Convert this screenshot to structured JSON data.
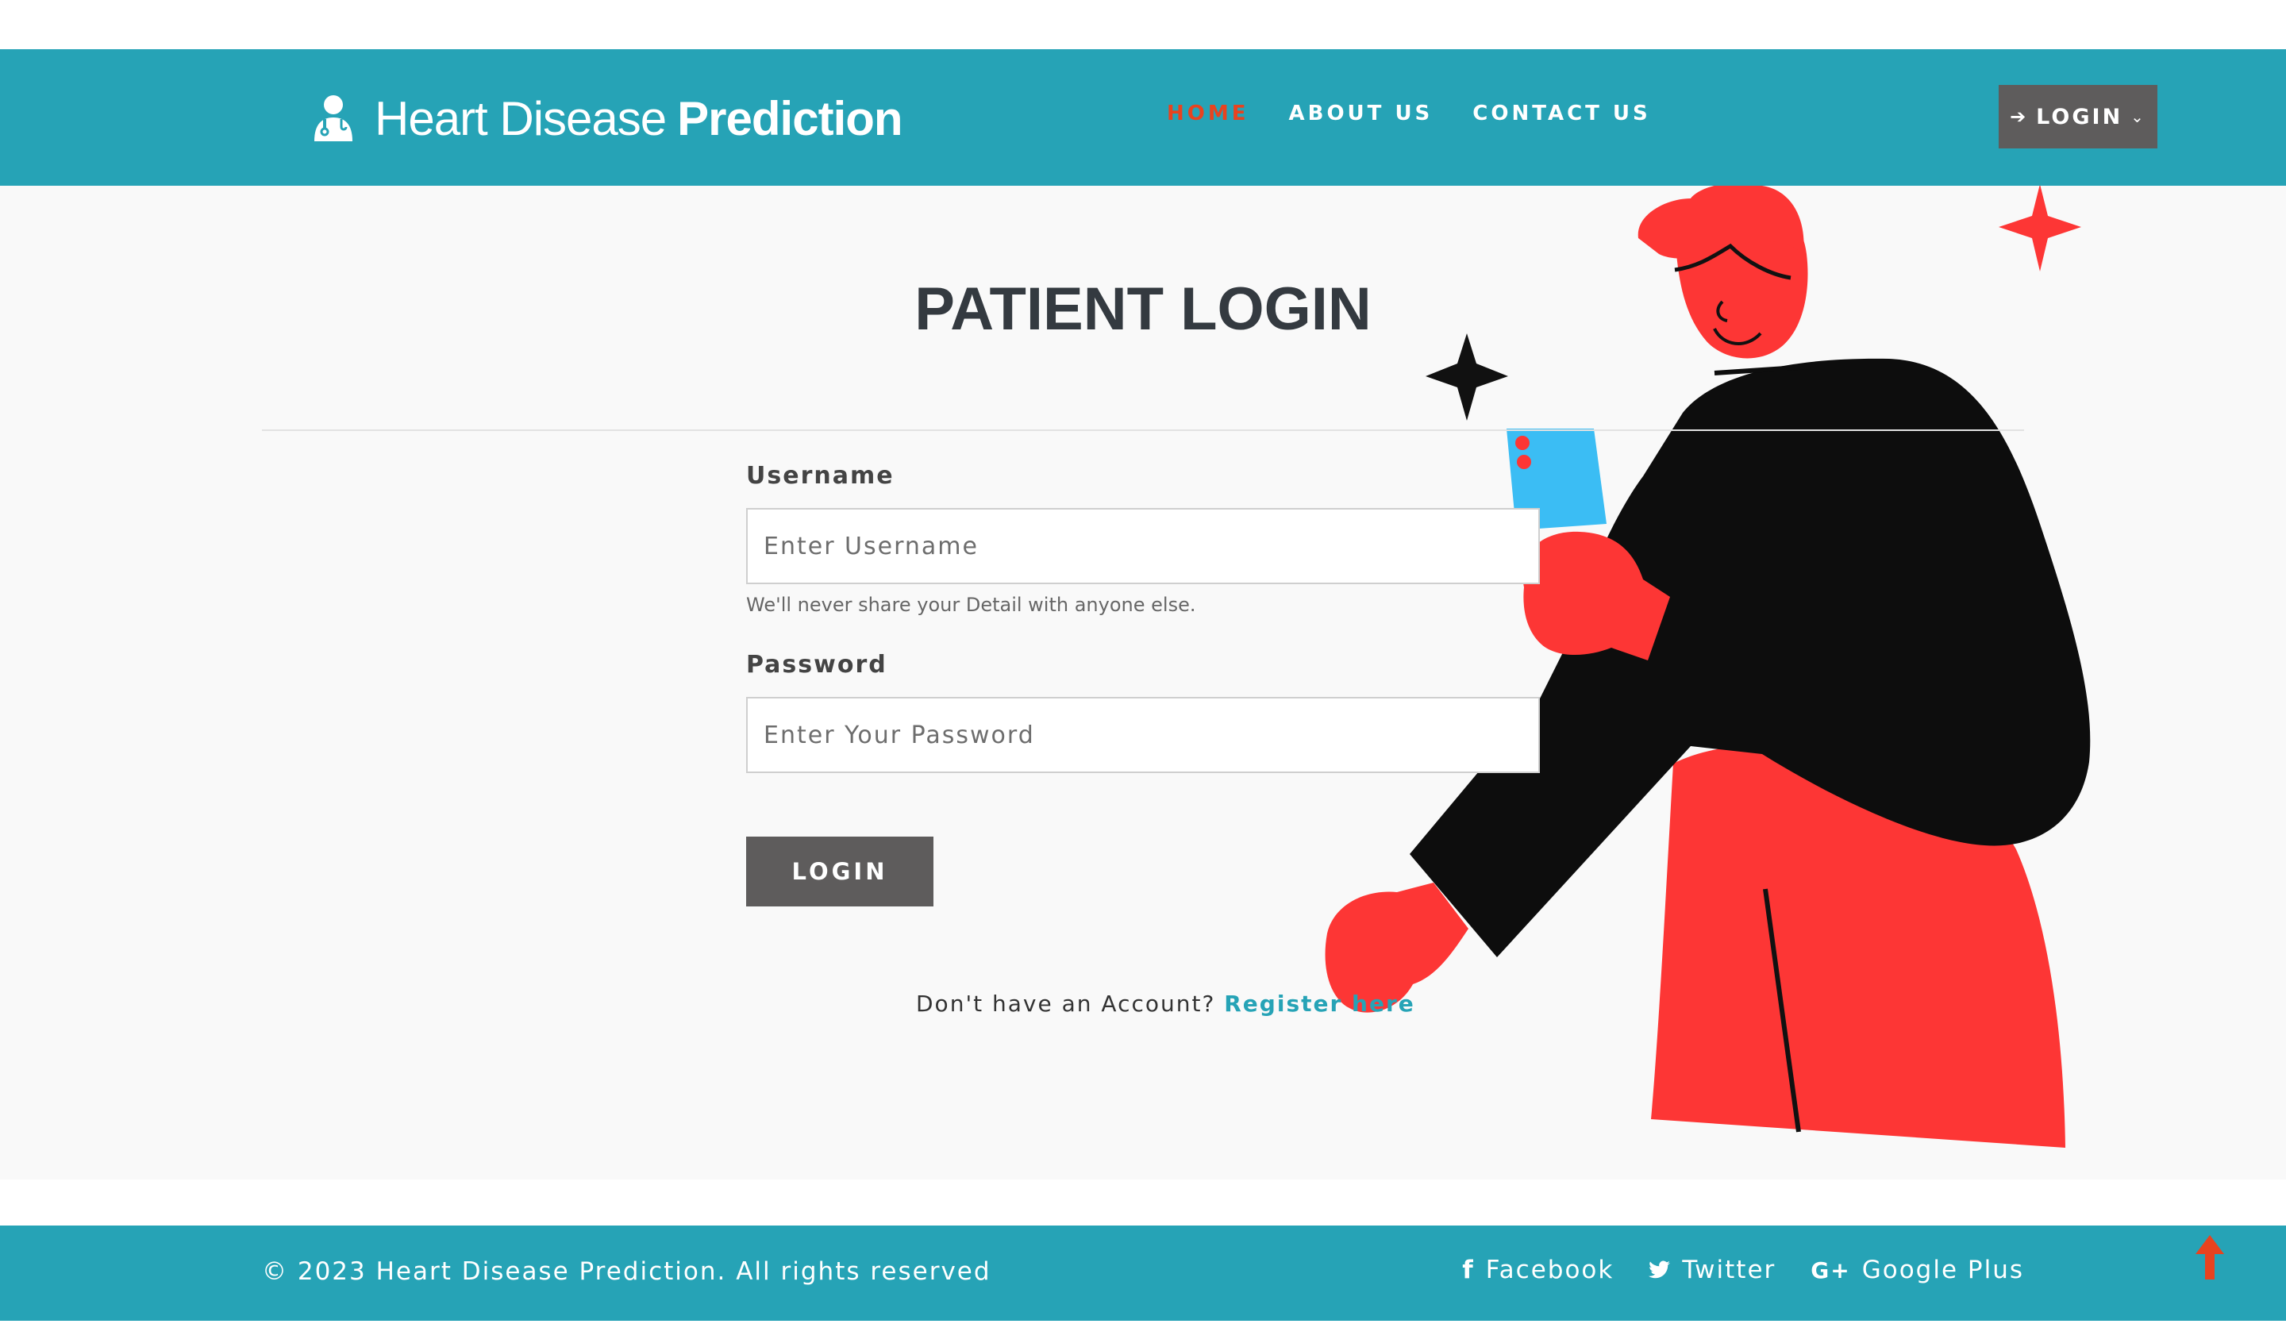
{
  "header": {
    "brand_light": "Heart Disease",
    "brand_bold": "Prediction",
    "brand_icon": "doctor-icon",
    "nav": [
      {
        "label": "HOME",
        "active": true
      },
      {
        "label": "ABOUT US",
        "active": false
      },
      {
        "label": "CONTACT US",
        "active": false
      }
    ],
    "login_label": "LOGIN",
    "login_icon": "sign-in-icon"
  },
  "main": {
    "title": "PATIENT LOGIN",
    "username_label": "Username",
    "username_placeholder": "Enter Username",
    "username_help": "We'll never share your Detail with anyone else.",
    "password_label": "Password",
    "password_placeholder": "Enter Your Password",
    "submit_label": "LOGIN",
    "register_text": "Don't have an Account?",
    "register_link": "Register here"
  },
  "footer": {
    "copyright": "© 2023 Heart Disease Prediction. All rights reserved",
    "social": [
      {
        "icon": "facebook-icon",
        "glyph": "f",
        "label": "Facebook"
      },
      {
        "icon": "twitter-icon",
        "glyph": "🐦",
        "label": "Twitter"
      },
      {
        "icon": "google-plus-icon",
        "glyph": "G+",
        "label": "Google Plus"
      }
    ]
  },
  "colors": {
    "primary": "#26a3b6",
    "accent": "#e8431f",
    "button": "#5e5c5c",
    "illustration_red": "#fd3635",
    "illustration_blue": "#3bbdf4"
  }
}
